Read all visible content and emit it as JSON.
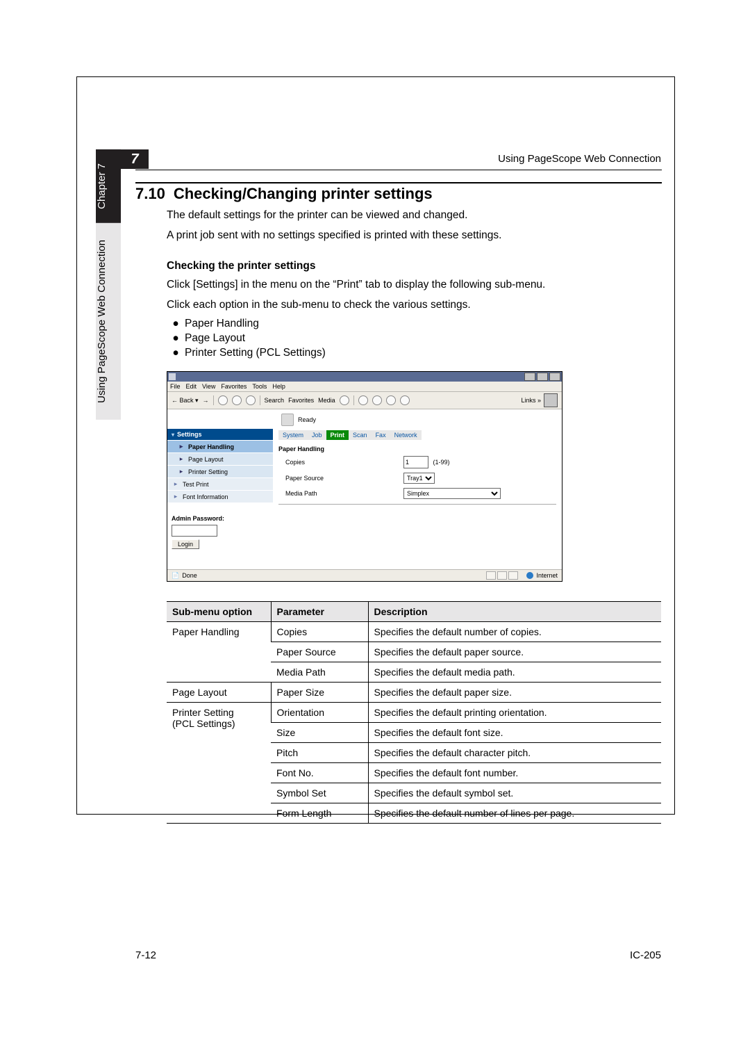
{
  "sidebar": {
    "chapter": "Chapter 7",
    "section": "Using PageScope Web Connection"
  },
  "header": {
    "chapter_number": "7",
    "running": "Using PageScope Web Connection"
  },
  "heading": {
    "number": "7.10",
    "title": "Checking/Changing printer settings"
  },
  "body": {
    "p1": "The default settings for the printer can be viewed and changed.",
    "p2": "A print job sent with no settings specified is printed with these settings.",
    "sub1": "Checking the printer settings",
    "p3": "Click [Settings] in the menu on the “Print” tab to display the following sub-menu.",
    "p4": "Click each option in the sub-menu to check the various settings."
  },
  "bullets": [
    "Paper Handling",
    "Page Layout",
    "Printer Setting (PCL Settings)"
  ],
  "browser": {
    "menus": [
      "File",
      "Edit",
      "View",
      "Favorites",
      "Tools",
      "Help"
    ],
    "toolbar": {
      "back": "← Back ▾",
      "search": "Search",
      "favorites": "Favorites",
      "media": "Media",
      "links": "Links »"
    },
    "left": {
      "header": "Settings",
      "items": [
        "Paper Handling",
        "Page Layout",
        "Printer Setting",
        "Test Print",
        "Font Information"
      ],
      "admin_label": "Admin Password:",
      "login": "Login"
    },
    "right": {
      "status": "Ready",
      "tabs": [
        "System",
        "Job",
        "Print",
        "Scan",
        "Fax",
        "Network"
      ],
      "heading": "Paper Handling",
      "rows": [
        {
          "label": "Copies",
          "value": "1",
          "range": "(1-99)"
        },
        {
          "label": "Paper Source",
          "value": "Tray1"
        },
        {
          "label": "Media Path",
          "value": "Simplex"
        }
      ]
    },
    "status": {
      "done": "Done",
      "zone": "Internet"
    }
  },
  "table": {
    "headers": [
      "Sub-menu option",
      "Parameter",
      "Description"
    ],
    "rows": [
      {
        "submenu": "Paper Handling",
        "param": "Copies",
        "desc": "Specifies the default number of copies."
      },
      {
        "param": "Paper Source",
        "desc": "Specifies the default paper source."
      },
      {
        "param": "Media Path",
        "desc": "Specifies the default media path."
      },
      {
        "submenu": "Page Layout",
        "param": "Paper Size",
        "desc": "Specifies the default paper size."
      },
      {
        "submenu_l1": "Printer Setting",
        "submenu_l2": "(PCL Settings)",
        "param": "Orientation",
        "desc": "Specifies the default printing orientation."
      },
      {
        "param": "Size",
        "desc": "Specifies the default font size."
      },
      {
        "param": "Pitch",
        "desc": "Specifies the default character pitch."
      },
      {
        "param": "Font No.",
        "desc": "Specifies the default font number."
      },
      {
        "param": "Symbol Set",
        "desc": "Specifies the default symbol set."
      },
      {
        "param": "Form Length",
        "desc": "Specifies the default number of lines per page."
      }
    ]
  },
  "footer": {
    "left": "7-12",
    "right": "IC-205"
  }
}
